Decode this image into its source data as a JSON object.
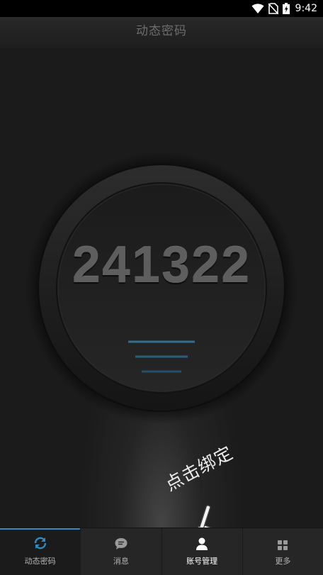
{
  "status_bar": {
    "time": "9:42"
  },
  "header": {
    "title": "动态密码"
  },
  "otp": {
    "code": "241322"
  },
  "bind_hint": {
    "text": "点击绑定"
  },
  "tabs": [
    {
      "label": "动态密码",
      "icon": "refresh-icon",
      "active": true
    },
    {
      "label": "消息",
      "icon": "chat-bubble-icon",
      "active": false
    },
    {
      "label": "账号管理",
      "icon": "person-icon",
      "active": false
    },
    {
      "label": "更多",
      "icon": "grid-icon",
      "active": false
    }
  ],
  "colors": {
    "accent": "#2f8bc0",
    "background": "#1c1c1c"
  }
}
